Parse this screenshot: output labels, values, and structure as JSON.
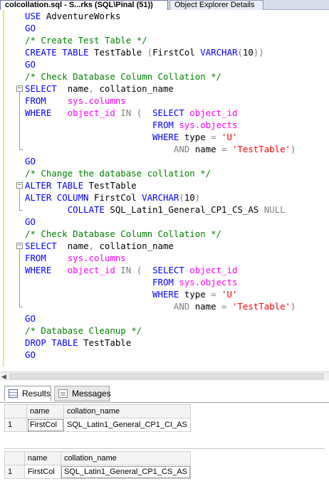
{
  "tabs": {
    "active": "colcollation.sql - S...rks (SQL\\Pinal (51))",
    "inactive": "Object Explorer Details"
  },
  "editor": {
    "lines": [
      {
        "fold": "",
        "tokens": [
          {
            "t": "USE ",
            "c": "kw"
          },
          {
            "t": "AdventureWorks",
            "c": "tx"
          }
        ]
      },
      {
        "fold": "",
        "tokens": [
          {
            "t": "GO",
            "c": "kw"
          }
        ]
      },
      {
        "fold": "",
        "tokens": [
          {
            "t": "/* Create Test Table */",
            "c": "cm"
          }
        ]
      },
      {
        "fold": "",
        "tokens": [
          {
            "t": "CREATE TABLE ",
            "c": "kw"
          },
          {
            "t": "TestTable ",
            "c": "tx"
          },
          {
            "t": "(",
            "c": "gy"
          },
          {
            "t": "FirstCol ",
            "c": "tx"
          },
          {
            "t": "VARCHAR",
            "c": "kw"
          },
          {
            "t": "(",
            "c": "gy"
          },
          {
            "t": "10",
            "c": "tx"
          },
          {
            "t": "))",
            "c": "gy"
          }
        ]
      },
      {
        "fold": "",
        "tokens": [
          {
            "t": "GO",
            "c": "kw"
          }
        ]
      },
      {
        "fold": "",
        "tokens": [
          {
            "t": "/* Check Database Column Collation */",
            "c": "cm"
          }
        ]
      },
      {
        "fold": "box",
        "tokens": [
          {
            "t": "SELECT  ",
            "c": "kw"
          },
          {
            "t": "name",
            "c": "tx"
          },
          {
            "t": ", ",
            "c": "gy"
          },
          {
            "t": "collation_name",
            "c": "tx"
          }
        ]
      },
      {
        "fold": "mid",
        "tokens": [
          {
            "t": "FROM    ",
            "c": "kw"
          },
          {
            "t": "sys.columns",
            "c": "fn"
          }
        ]
      },
      {
        "fold": "mid",
        "tokens": [
          {
            "t": "WHERE   ",
            "c": "kw"
          },
          {
            "t": "object_id ",
            "c": "fn"
          },
          {
            "t": "IN ",
            "c": "gy"
          },
          {
            "t": "(  ",
            "c": "gy"
          },
          {
            "t": "SELECT ",
            "c": "kw"
          },
          {
            "t": "object_id",
            "c": "fn"
          }
        ]
      },
      {
        "fold": "mid",
        "tokens": [
          {
            "t": "                        ",
            "c": "tx"
          },
          {
            "t": "FROM ",
            "c": "kw"
          },
          {
            "t": "sys.objects",
            "c": "fn"
          }
        ]
      },
      {
        "fold": "mid",
        "tokens": [
          {
            "t": "                        ",
            "c": "tx"
          },
          {
            "t": "WHERE ",
            "c": "kw"
          },
          {
            "t": "type ",
            "c": "tx"
          },
          {
            "t": "= ",
            "c": "gy"
          },
          {
            "t": "'U'",
            "c": "st"
          }
        ]
      },
      {
        "fold": "end",
        "tokens": [
          {
            "t": "                            ",
            "c": "tx"
          },
          {
            "t": "AND ",
            "c": "gy"
          },
          {
            "t": "name ",
            "c": "tx"
          },
          {
            "t": "= ",
            "c": "gy"
          },
          {
            "t": "'TestTable'",
            "c": "st"
          },
          {
            "t": ")",
            "c": "gy"
          }
        ]
      },
      {
        "fold": "",
        "tokens": [
          {
            "t": "GO",
            "c": "kw"
          }
        ]
      },
      {
        "fold": "",
        "tokens": [
          {
            "t": "/* Change the database collation */",
            "c": "cm"
          }
        ]
      },
      {
        "fold": "box",
        "tokens": [
          {
            "t": "ALTER TABLE ",
            "c": "kw"
          },
          {
            "t": "TestTable",
            "c": "tx"
          }
        ]
      },
      {
        "fold": "mid",
        "tokens": [
          {
            "t": "ALTER COLUMN ",
            "c": "kw"
          },
          {
            "t": "FirstCol ",
            "c": "tx"
          },
          {
            "t": "VARCHAR",
            "c": "kw"
          },
          {
            "t": "(",
            "c": "gy"
          },
          {
            "t": "10",
            "c": "tx"
          },
          {
            "t": ")",
            "c": "gy"
          }
        ]
      },
      {
        "fold": "end",
        "tokens": [
          {
            "t": "        ",
            "c": "tx"
          },
          {
            "t": "COLLATE ",
            "c": "kw"
          },
          {
            "t": "SQL_Latin1_General_CP1_CS_AS ",
            "c": "tx"
          },
          {
            "t": "NULL",
            "c": "gy"
          }
        ]
      },
      {
        "fold": "",
        "tokens": [
          {
            "t": "GO",
            "c": "kw"
          }
        ]
      },
      {
        "fold": "",
        "tokens": [
          {
            "t": "/* Check Database Column Collation */",
            "c": "cm"
          }
        ]
      },
      {
        "fold": "box",
        "tokens": [
          {
            "t": "SELECT  ",
            "c": "kw"
          },
          {
            "t": "name",
            "c": "tx"
          },
          {
            "t": ", ",
            "c": "gy"
          },
          {
            "t": "collation_name",
            "c": "tx"
          }
        ]
      },
      {
        "fold": "mid",
        "tokens": [
          {
            "t": "FROM    ",
            "c": "kw"
          },
          {
            "t": "sys.columns",
            "c": "fn"
          }
        ]
      },
      {
        "fold": "mid",
        "tokens": [
          {
            "t": "WHERE   ",
            "c": "kw"
          },
          {
            "t": "object_id ",
            "c": "fn"
          },
          {
            "t": "IN ",
            "c": "gy"
          },
          {
            "t": "(  ",
            "c": "gy"
          },
          {
            "t": "SELECT ",
            "c": "kw"
          },
          {
            "t": "object_id",
            "c": "fn"
          }
        ]
      },
      {
        "fold": "mid",
        "tokens": [
          {
            "t": "                        ",
            "c": "tx"
          },
          {
            "t": "FROM ",
            "c": "kw"
          },
          {
            "t": "sys.objects",
            "c": "fn"
          }
        ]
      },
      {
        "fold": "mid",
        "tokens": [
          {
            "t": "                        ",
            "c": "tx"
          },
          {
            "t": "WHERE ",
            "c": "kw"
          },
          {
            "t": "type ",
            "c": "tx"
          },
          {
            "t": "= ",
            "c": "gy"
          },
          {
            "t": "'U'",
            "c": "st"
          }
        ]
      },
      {
        "fold": "end",
        "tokens": [
          {
            "t": "                            ",
            "c": "tx"
          },
          {
            "t": "AND ",
            "c": "gy"
          },
          {
            "t": "name ",
            "c": "tx"
          },
          {
            "t": "= ",
            "c": "gy"
          },
          {
            "t": "'TestTable'",
            "c": "st"
          },
          {
            "t": ")",
            "c": "gy"
          }
        ]
      },
      {
        "fold": "",
        "tokens": [
          {
            "t": "GO",
            "c": "kw"
          }
        ]
      },
      {
        "fold": "",
        "tokens": [
          {
            "t": "/* Database Cleanup */",
            "c": "cm"
          }
        ]
      },
      {
        "fold": "",
        "tokens": [
          {
            "t": "DROP TABLE ",
            "c": "kw"
          },
          {
            "t": "TestTable",
            "c": "tx"
          }
        ]
      },
      {
        "fold": "",
        "tokens": [
          {
            "t": "GO",
            "c": "kw"
          }
        ]
      }
    ],
    "colors": {
      "keyword": "#0000ff",
      "comment": "#008000",
      "system_object": "#ff00ff",
      "string": "#ff0000",
      "operator": "#808080"
    }
  },
  "results_tabs": {
    "results": "Results",
    "messages": "Messages"
  },
  "grids": [
    {
      "columns": [
        "name",
        "collation_name"
      ],
      "rows": [
        {
          "num": "1",
          "cells": [
            "FirstCol",
            "SQL_Latin1_General_CP1_CI_AS"
          ]
        }
      ]
    },
    {
      "columns": [
        "name",
        "collation_name"
      ],
      "rows": [
        {
          "num": "1",
          "cells": [
            "FirstCol",
            "SQL_Latin1_General_CP1_CS_AS"
          ]
        }
      ]
    }
  ]
}
